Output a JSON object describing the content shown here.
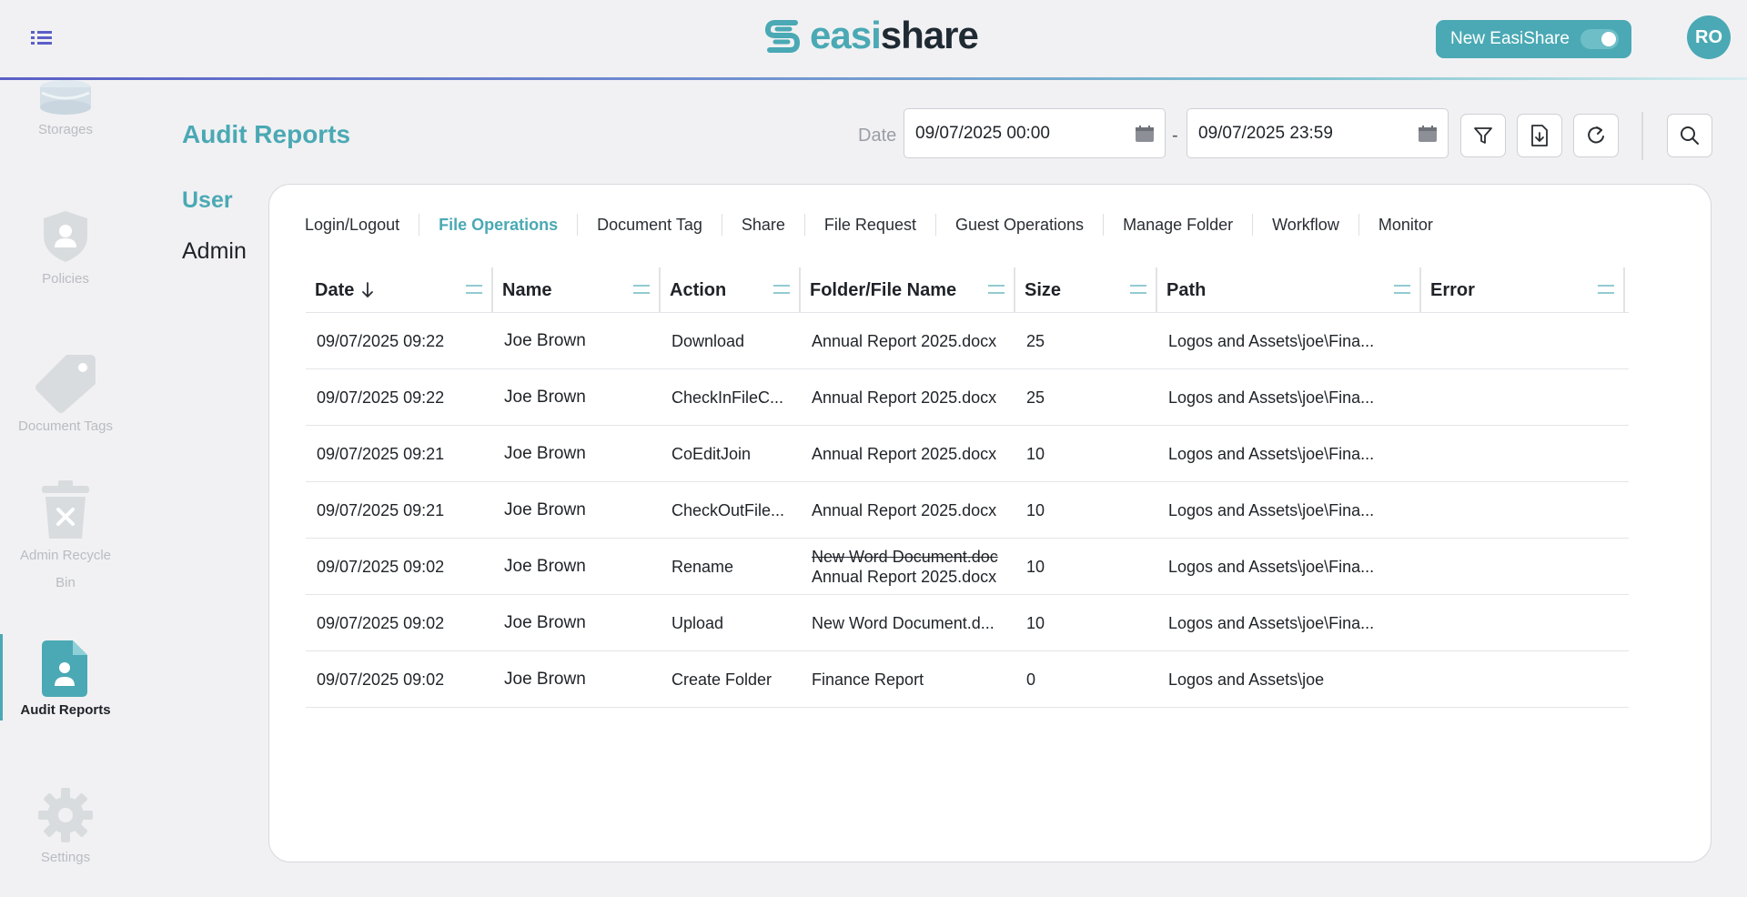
{
  "header": {
    "logo_easi": "easi",
    "logo_share": "share",
    "toggle_label": "New EasiShare",
    "avatar_initials": "RO",
    "brand_color": "#4aa9b4"
  },
  "sidenav": {
    "items": [
      {
        "label": "Storages",
        "icon": "database-icon"
      },
      {
        "label": "Policies",
        "icon": "shield-user-icon"
      },
      {
        "label": "Document Tags",
        "icon": "tag-icon"
      },
      {
        "label": "Admin Recycle Bin",
        "icon": "trash-icon"
      },
      {
        "label": "Audit Reports",
        "icon": "report-user-icon",
        "active": true
      },
      {
        "label": "Settings",
        "icon": "gear-icon"
      }
    ]
  },
  "page": {
    "title": "Audit Reports",
    "date_label": "Date",
    "date_from": "09/07/2025 00:00",
    "date_to": "09/07/2025 23:59",
    "date_separator": "-"
  },
  "subnav": {
    "user": "User",
    "admin": "Admin"
  },
  "tabs": [
    "Login/Logout",
    "File Operations",
    "Document Tag",
    "Share",
    "File Request",
    "Guest Operations",
    "Manage Folder",
    "Workflow",
    "Monitor"
  ],
  "active_tab": "File Operations",
  "table": {
    "columns": [
      "Date",
      "Name",
      "Action",
      "Folder/File Name",
      "Size",
      "Path",
      "Error"
    ],
    "rows": [
      {
        "date": "09/07/2025 09:22",
        "name": "Joe Brown",
        "action": "Download",
        "file": "Annual Report 2025.docx",
        "file_old": "",
        "size": "25",
        "path": "Logos and Assets\\joe\\Fina...",
        "error": ""
      },
      {
        "date": "09/07/2025 09:22",
        "name": "Joe Brown",
        "action": "CheckInFileC...",
        "file": "Annual Report 2025.docx",
        "file_old": "",
        "size": "25",
        "path": "Logos and Assets\\joe\\Fina...",
        "error": ""
      },
      {
        "date": "09/07/2025 09:21",
        "name": "Joe Brown",
        "action": "CoEditJoin",
        "file": "Annual Report 2025.docx",
        "file_old": "",
        "size": "10",
        "path": "Logos and Assets\\joe\\Fina...",
        "error": ""
      },
      {
        "date": "09/07/2025 09:21",
        "name": "Joe Brown",
        "action": "CheckOutFile...",
        "file": "Annual Report 2025.docx",
        "file_old": "",
        "size": "10",
        "path": "Logos and Assets\\joe\\Fina...",
        "error": ""
      },
      {
        "date": "09/07/2025 09:02",
        "name": "Joe Brown",
        "action": "Rename",
        "file": "Annual Report 2025.docx",
        "file_old": "New Word Document.doc",
        "size": "10",
        "path": "Logos and Assets\\joe\\Fina...",
        "error": ""
      },
      {
        "date": "09/07/2025 09:02",
        "name": "Joe Brown",
        "action": "Upload",
        "file": "New Word Document.d...",
        "file_old": "",
        "size": "10",
        "path": "Logos and Assets\\joe\\Fina...",
        "error": ""
      },
      {
        "date": "09/07/2025 09:02",
        "name": "Joe Brown",
        "action": "Create Folder",
        "file": "Finance Report",
        "file_old": "",
        "size": "0",
        "path": "Logos and Assets\\joe",
        "error": ""
      }
    ]
  }
}
